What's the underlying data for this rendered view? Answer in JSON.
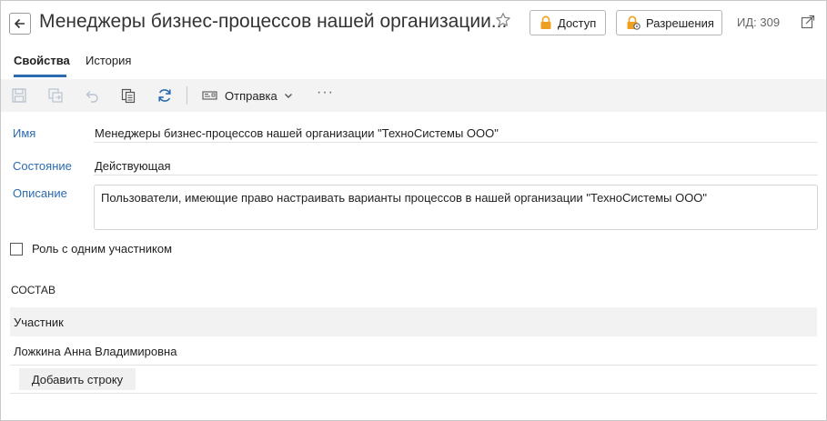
{
  "header": {
    "title": "Менеджеры бизнес-процессов нашей организации...",
    "access_button": "Доступ",
    "permissions_button": "Разрешения",
    "id_label": "ИД: 309"
  },
  "tabs": [
    {
      "label": "Свойства",
      "active": true
    },
    {
      "label": "История",
      "active": false
    }
  ],
  "toolbar": {
    "send_label": "Отправка",
    "more_label": "···"
  },
  "form": {
    "name_label": "Имя",
    "name_value": "Менеджеры бизнес-процессов нашей организации \"ТехноСистемы ООО\"",
    "state_label": "Состояние",
    "state_value": "Действующая",
    "description_label": "Описание",
    "description_value": "Пользователи, имеющие право настраивать варианты процессов в нашей организации \"ТехноСистемы ООО\"",
    "single_participant_label": "Роль с одним участником",
    "single_participant_checked": false
  },
  "composition": {
    "section_title": "СОСТАВ",
    "column_header": "Участник",
    "rows": [
      "Ложкина Анна Владимировна"
    ],
    "add_row_label": "Добавить строку"
  },
  "colors": {
    "accent": "#2b6cb0",
    "lock_icon": "#f0a020"
  }
}
